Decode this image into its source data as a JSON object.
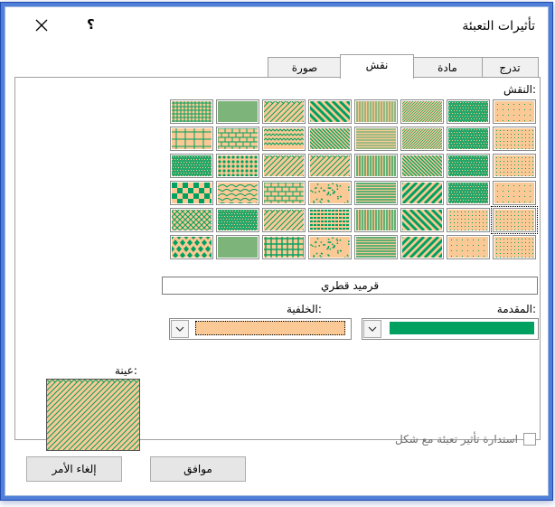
{
  "dialog": {
    "title": "تأثيرات التعبئة",
    "help_label": "؟",
    "close_icon": "close-icon"
  },
  "tabs": [
    {
      "label": "تدرج"
    },
    {
      "label": "مادة"
    },
    {
      "label": "نقش",
      "active": true
    },
    {
      "label": "صورة"
    }
  ],
  "pattern": {
    "label": "النقش:",
    "selected_name": "قرميد قطري",
    "selected_index": 32
  },
  "colors": {
    "foreground_label": "المقدمة:",
    "background_label": "الخلفية:",
    "foreground": "#00a060",
    "background": "#fac995",
    "dropdown_icon": "chevron-down-icon"
  },
  "sample_label": "عينة:",
  "rotate_with_shape": {
    "label": "استدارة تأثير تعبئة مع شكل",
    "checked": false
  },
  "buttons": {
    "ok": "موافق",
    "cancel": "إلغاء الأمر"
  }
}
